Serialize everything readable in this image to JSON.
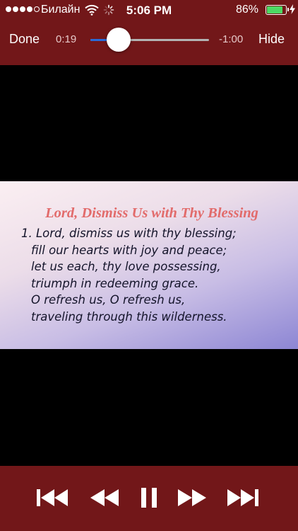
{
  "status_bar": {
    "carrier": "Билайн",
    "time": "5:06 PM",
    "battery_percent": "86%",
    "battery_level": 0.86,
    "signal_bars_filled": 4,
    "signal_bars_total": 5,
    "icons": [
      "wifi-icon",
      "loading-spinner-icon",
      "battery-icon",
      "charging-bolt-icon"
    ]
  },
  "player": {
    "done_label": "Done",
    "hide_label": "Hide",
    "elapsed": "0:19",
    "remaining": "-1:00",
    "progress": 0.24
  },
  "slide": {
    "title": "Lord, Dismiss Us with Thy Blessing",
    "lines": [
      "1.  Lord, dismiss us with thy blessing;",
      "fill our hearts with joy and peace;",
      "let us each, thy love possessing,",
      "triumph in redeeming grace.",
      "O refresh us, O refresh us,",
      "traveling through this wilderness."
    ]
  },
  "transport": {
    "icons": [
      "skip-back-icon",
      "rewind-icon",
      "pause-icon",
      "fast-forward-icon",
      "skip-forward-icon"
    ]
  },
  "colors": {
    "bar_background": "#721719",
    "progress_fill": "#2a6bd9",
    "title_color": "#e26b6b",
    "battery_fill": "#4cd964"
  }
}
